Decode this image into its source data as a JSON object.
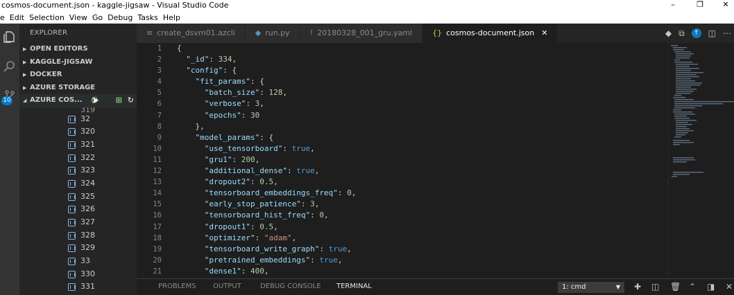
{
  "window": {
    "title": "cosmos-document.json - kaggle-jigsaw - Visual Studio Code",
    "minimize": "–",
    "restore": "❐",
    "close": "✕"
  },
  "menu": [
    "e",
    "Edit",
    "Selection",
    "View",
    "Go",
    "Debug",
    "Tasks",
    "Help"
  ],
  "activity_bar": {
    "scm_badge": "10"
  },
  "sidebar": {
    "title": "EXPLORER",
    "sections": [
      {
        "label": "OPEN EDITORS"
      },
      {
        "label": "KAGGLE-JIGSAW"
      },
      {
        "label": "DOCKER"
      },
      {
        "label": "AZURE STORAGE"
      },
      {
        "label": "AZURE COS..."
      }
    ],
    "documents": [
      "32",
      "320",
      "321",
      "322",
      "323",
      "324",
      "325",
      "326",
      "327",
      "328",
      "329",
      "33",
      "330",
      "331"
    ],
    "partial_top": "319"
  },
  "tabs": [
    {
      "label": "create_dsvm01.azcli",
      "icon": "≡",
      "color": "#8a8a8a"
    },
    {
      "label": "run.py",
      "icon": "◆",
      "color": "#519aba"
    },
    {
      "label": "20180328_001_gru.yaml",
      "icon": "!",
      "color": "#a074c4"
    },
    {
      "label": "cosmos-document.json",
      "icon": "{}",
      "color": "#cbcb41"
    }
  ],
  "editor": {
    "lines": [
      {
        "n": "1",
        "html": "<span style=\"color:#d4d4d4\">{</span>"
      },
      {
        "n": "2",
        "html": "  <span class=\"k\">\"_id\"</span>: <span class=\"n\">334</span>,"
      },
      {
        "n": "3",
        "html": "  <span class=\"k\">\"config\"</span>: {"
      },
      {
        "n": "4",
        "html": "    <span class=\"k\">\"fit_params\"</span>: {"
      },
      {
        "n": "5",
        "html": "      <span class=\"k\">\"batch_size\"</span>: <span class=\"n\">128</span>,"
      },
      {
        "n": "6",
        "html": "      <span class=\"k\">\"verbose\"</span>: <span class=\"n\">3</span>,"
      },
      {
        "n": "7",
        "html": "      <span class=\"k\">\"epochs\"</span>: <span class=\"n\">30</span>"
      },
      {
        "n": "8",
        "html": "    },"
      },
      {
        "n": "9",
        "html": "    <span class=\"k\">\"model_params\"</span>: {"
      },
      {
        "n": "10",
        "html": "      <span class=\"k\">\"use_tensorboard\"</span>: <span class=\"b\">true</span>,"
      },
      {
        "n": "11",
        "html": "      <span class=\"k\">\"gru1\"</span>: <span class=\"n\">200</span>,"
      },
      {
        "n": "12",
        "html": "      <span class=\"k\">\"additional_dense\"</span>: <span class=\"b\">true</span>,"
      },
      {
        "n": "13",
        "html": "      <span class=\"k\">\"dropout2\"</span>: <span class=\"n\">0.5</span>,"
      },
      {
        "n": "14",
        "html": "      <span class=\"k\">\"tensorboard_embeddings_freq\"</span>: <span class=\"n\">0</span>,"
      },
      {
        "n": "15",
        "html": "      <span class=\"k\">\"early_stop_patience\"</span>: <span class=\"n\">3</span>,"
      },
      {
        "n": "16",
        "html": "      <span class=\"k\">\"tensorboard_hist_freq\"</span>: <span class=\"n\">0</span>,"
      },
      {
        "n": "17",
        "html": "      <span class=\"k\">\"dropout1\"</span>: <span class=\"n\">0.5</span>,"
      },
      {
        "n": "18",
        "html": "      <span class=\"k\">\"optimizer\"</span>: <span class=\"s\">\"adam\"</span>,"
      },
      {
        "n": "19",
        "html": "      <span class=\"k\">\"tensorboard_write_graph\"</span>: <span class=\"b\">true</span>,"
      },
      {
        "n": "20",
        "html": "      <span class=\"k\">\"pretrained_embeddings\"</span>: <span class=\"b\">true</span>,"
      },
      {
        "n": "21",
        "html": "      <span class=\"k\">\"dense1\"</span>: <span class=\"n\">400</span>,"
      }
    ]
  },
  "panel": {
    "tabs": [
      "PROBLEMS",
      "OUTPUT",
      "DEBUG CONSOLE",
      "TERMINAL"
    ],
    "active": "TERMINAL",
    "terminal_select": "1: cmd"
  }
}
